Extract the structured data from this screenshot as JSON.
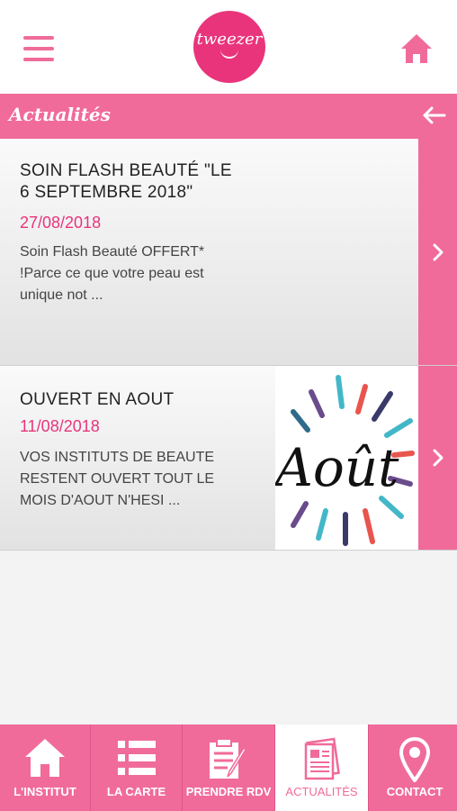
{
  "header": {
    "logo_text": "tweezer",
    "menu_icon": "hamburger-menu-icon",
    "home_icon": "home-icon"
  },
  "page": {
    "title": "Actualités",
    "back_icon": "arrow-left-icon"
  },
  "news": [
    {
      "title": "SOIN FLASH BEAUTÉ \"LE 6 SEPTEMBRE 2018\"",
      "date": "27/08/2018",
      "excerpt": "Soin Flash Beauté OFFERT* !Parce ce que votre peau est unique not ..."
    },
    {
      "title": "OUVERT EN AOUT",
      "date": "11/08/2018",
      "excerpt": "VOS INSTITUTS DE BEAUTE RESTENT OUVERT TOUT LE MOIS D'AOUT N'HESI ...",
      "image_text": "Août"
    }
  ],
  "tabs": [
    {
      "label": "L'INSTITUT",
      "icon": "home-icon"
    },
    {
      "label": "LA CARTE",
      "icon": "list-icon"
    },
    {
      "label": "PRENDRE RDV",
      "icon": "clipboard-edit-icon"
    },
    {
      "label": "ACTUALITÉS",
      "icon": "newspaper-icon",
      "active": true
    },
    {
      "label": "CONTACT",
      "icon": "map-pin-icon"
    }
  ],
  "colors": {
    "accent": "#f06b9a",
    "brand": "#e9347b",
    "date": "#e9347b"
  }
}
